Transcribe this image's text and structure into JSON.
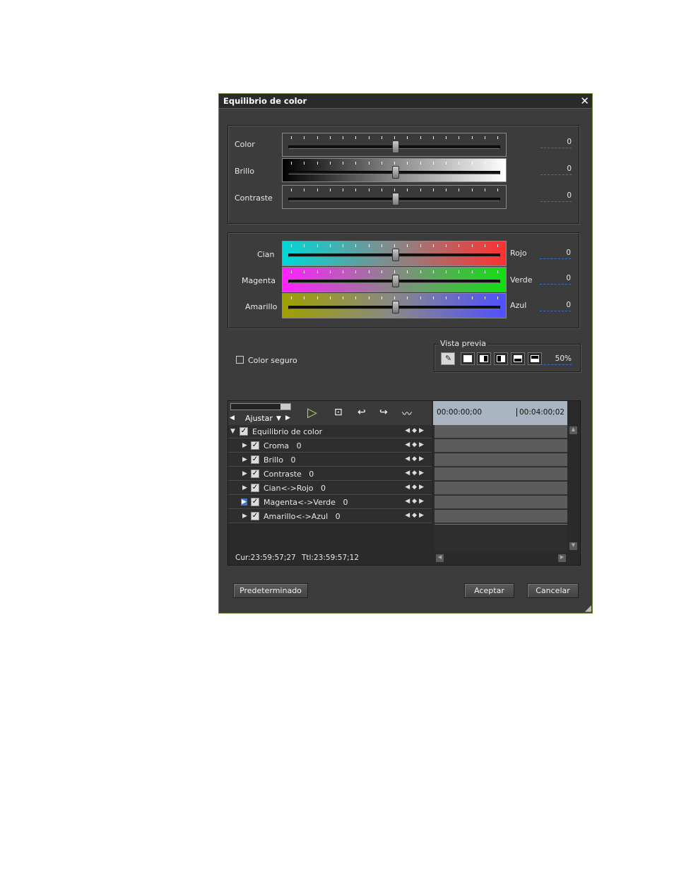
{
  "dialog": {
    "title": "Equilibrio de color",
    "close_glyph": "✕"
  },
  "basic": {
    "rows": [
      {
        "label": "Color",
        "value": "0"
      },
      {
        "label": "Brillo",
        "value": "0"
      },
      {
        "label": "Contraste",
        "value": "0"
      }
    ]
  },
  "balance": {
    "rows": [
      {
        "left": "Cian",
        "right": "Rojo",
        "value": "0"
      },
      {
        "left": "Magenta",
        "right": "Verde",
        "value": "0"
      },
      {
        "left": "Amarillo",
        "right": "Azul",
        "value": "0"
      }
    ]
  },
  "safe_color": {
    "label": "Color seguro",
    "checked": false
  },
  "preview": {
    "title": "Vista previa",
    "percent": "50%"
  },
  "timeline": {
    "fit_label": "Ajustar",
    "time_start": "00:00:00;00",
    "time_mid": "00:04:00;02",
    "cur": "Cur:23:59:57;27",
    "ttl": "Ttl:23:59:57;12",
    "root": "Equilibrio de color",
    "tracks": [
      {
        "name": "Croma",
        "value": "0"
      },
      {
        "name": "Brillo",
        "value": "0"
      },
      {
        "name": "Contraste",
        "value": "0"
      },
      {
        "name": "Cian<->Rojo",
        "value": "0"
      },
      {
        "name": "Magenta<->Verde",
        "value": "0"
      },
      {
        "name": "Amarillo<->Azul",
        "value": "0"
      }
    ]
  },
  "buttons": {
    "default": "Predeterminado",
    "ok": "Aceptar",
    "cancel": "Cancelar"
  }
}
